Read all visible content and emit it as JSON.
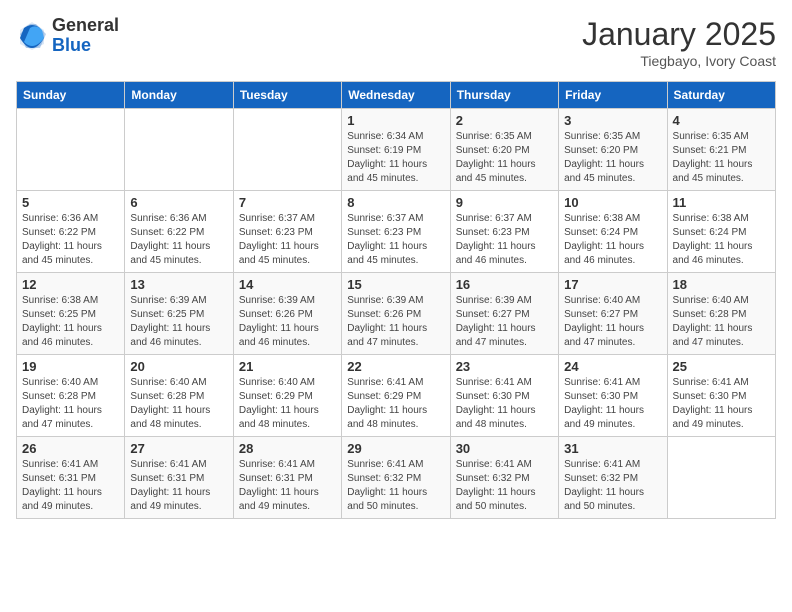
{
  "header": {
    "logo_general": "General",
    "logo_blue": "Blue",
    "month_title": "January 2025",
    "subtitle": "Tiegbayo, Ivory Coast"
  },
  "days_of_week": [
    "Sunday",
    "Monday",
    "Tuesday",
    "Wednesday",
    "Thursday",
    "Friday",
    "Saturday"
  ],
  "weeks": [
    [
      {
        "day": "",
        "info": ""
      },
      {
        "day": "",
        "info": ""
      },
      {
        "day": "",
        "info": ""
      },
      {
        "day": "1",
        "info": "Sunrise: 6:34 AM\nSunset: 6:19 PM\nDaylight: 11 hours\nand 45 minutes."
      },
      {
        "day": "2",
        "info": "Sunrise: 6:35 AM\nSunset: 6:20 PM\nDaylight: 11 hours\nand 45 minutes."
      },
      {
        "day": "3",
        "info": "Sunrise: 6:35 AM\nSunset: 6:20 PM\nDaylight: 11 hours\nand 45 minutes."
      },
      {
        "day": "4",
        "info": "Sunrise: 6:35 AM\nSunset: 6:21 PM\nDaylight: 11 hours\nand 45 minutes."
      }
    ],
    [
      {
        "day": "5",
        "info": "Sunrise: 6:36 AM\nSunset: 6:22 PM\nDaylight: 11 hours\nand 45 minutes."
      },
      {
        "day": "6",
        "info": "Sunrise: 6:36 AM\nSunset: 6:22 PM\nDaylight: 11 hours\nand 45 minutes."
      },
      {
        "day": "7",
        "info": "Sunrise: 6:37 AM\nSunset: 6:23 PM\nDaylight: 11 hours\nand 45 minutes."
      },
      {
        "day": "8",
        "info": "Sunrise: 6:37 AM\nSunset: 6:23 PM\nDaylight: 11 hours\nand 45 minutes."
      },
      {
        "day": "9",
        "info": "Sunrise: 6:37 AM\nSunset: 6:23 PM\nDaylight: 11 hours\nand 46 minutes."
      },
      {
        "day": "10",
        "info": "Sunrise: 6:38 AM\nSunset: 6:24 PM\nDaylight: 11 hours\nand 46 minutes."
      },
      {
        "day": "11",
        "info": "Sunrise: 6:38 AM\nSunset: 6:24 PM\nDaylight: 11 hours\nand 46 minutes."
      }
    ],
    [
      {
        "day": "12",
        "info": "Sunrise: 6:38 AM\nSunset: 6:25 PM\nDaylight: 11 hours\nand 46 minutes."
      },
      {
        "day": "13",
        "info": "Sunrise: 6:39 AM\nSunset: 6:25 PM\nDaylight: 11 hours\nand 46 minutes."
      },
      {
        "day": "14",
        "info": "Sunrise: 6:39 AM\nSunset: 6:26 PM\nDaylight: 11 hours\nand 46 minutes."
      },
      {
        "day": "15",
        "info": "Sunrise: 6:39 AM\nSunset: 6:26 PM\nDaylight: 11 hours\nand 47 minutes."
      },
      {
        "day": "16",
        "info": "Sunrise: 6:39 AM\nSunset: 6:27 PM\nDaylight: 11 hours\nand 47 minutes."
      },
      {
        "day": "17",
        "info": "Sunrise: 6:40 AM\nSunset: 6:27 PM\nDaylight: 11 hours\nand 47 minutes."
      },
      {
        "day": "18",
        "info": "Sunrise: 6:40 AM\nSunset: 6:28 PM\nDaylight: 11 hours\nand 47 minutes."
      }
    ],
    [
      {
        "day": "19",
        "info": "Sunrise: 6:40 AM\nSunset: 6:28 PM\nDaylight: 11 hours\nand 47 minutes."
      },
      {
        "day": "20",
        "info": "Sunrise: 6:40 AM\nSunset: 6:28 PM\nDaylight: 11 hours\nand 48 minutes."
      },
      {
        "day": "21",
        "info": "Sunrise: 6:40 AM\nSunset: 6:29 PM\nDaylight: 11 hours\nand 48 minutes."
      },
      {
        "day": "22",
        "info": "Sunrise: 6:41 AM\nSunset: 6:29 PM\nDaylight: 11 hours\nand 48 minutes."
      },
      {
        "day": "23",
        "info": "Sunrise: 6:41 AM\nSunset: 6:30 PM\nDaylight: 11 hours\nand 48 minutes."
      },
      {
        "day": "24",
        "info": "Sunrise: 6:41 AM\nSunset: 6:30 PM\nDaylight: 11 hours\nand 49 minutes."
      },
      {
        "day": "25",
        "info": "Sunrise: 6:41 AM\nSunset: 6:30 PM\nDaylight: 11 hours\nand 49 minutes."
      }
    ],
    [
      {
        "day": "26",
        "info": "Sunrise: 6:41 AM\nSunset: 6:31 PM\nDaylight: 11 hours\nand 49 minutes."
      },
      {
        "day": "27",
        "info": "Sunrise: 6:41 AM\nSunset: 6:31 PM\nDaylight: 11 hours\nand 49 minutes."
      },
      {
        "day": "28",
        "info": "Sunrise: 6:41 AM\nSunset: 6:31 PM\nDaylight: 11 hours\nand 49 minutes."
      },
      {
        "day": "29",
        "info": "Sunrise: 6:41 AM\nSunset: 6:32 PM\nDaylight: 11 hours\nand 50 minutes."
      },
      {
        "day": "30",
        "info": "Sunrise: 6:41 AM\nSunset: 6:32 PM\nDaylight: 11 hours\nand 50 minutes."
      },
      {
        "day": "31",
        "info": "Sunrise: 6:41 AM\nSunset: 6:32 PM\nDaylight: 11 hours\nand 50 minutes."
      },
      {
        "day": "",
        "info": ""
      }
    ]
  ]
}
